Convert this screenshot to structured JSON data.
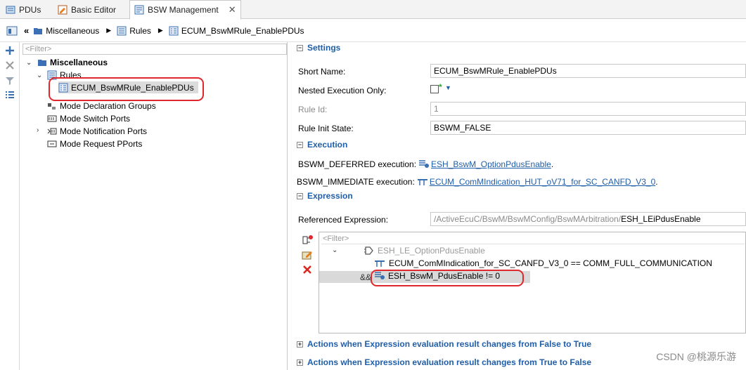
{
  "tabs": [
    {
      "label": "PDUs",
      "icon": "pdus-icon"
    },
    {
      "label": "Basic Editor",
      "icon": "basic-editor-icon"
    },
    {
      "label": "BSW Management",
      "icon": "bsw-management-icon",
      "close": "✕"
    }
  ],
  "breadcrumb": {
    "items": [
      "Miscellaneous",
      "Rules",
      "ECUM_BswMRule_EnablePDUs"
    ]
  },
  "tree": {
    "filter_placeholder": "<Filter>",
    "root": "Miscellaneous",
    "rules": "Rules",
    "selected_rule": "ECUM_BswMRule_EnablePDUs",
    "items": [
      "Mode Declaration Groups",
      "Mode Switch Ports",
      "Mode Notification Ports",
      "Mode Request PPorts"
    ]
  },
  "settings": {
    "title": "Settings",
    "short_name_label": "Short Name:",
    "short_name_value": "ECUM_BswMRule_EnablePDUs",
    "nested_label": "Nested Execution Only:",
    "rule_id_label": "Rule Id:",
    "rule_id_value": "1",
    "init_state_label": "Rule Init State:",
    "init_state_value": "BSWM_FALSE"
  },
  "execution": {
    "title": "Execution",
    "deferred_label": "BSWM_DEFERRED execution:",
    "deferred_link": "ESH_BswM_OptionPdusEnable",
    "immediate_label": "BSWM_IMMEDIATE execution:",
    "immediate_link": "ECUM_ComMIndication_HUT_oV71_for_SC_CANFD_V3_0"
  },
  "expression": {
    "title": "Expression",
    "ref_label": "Referenced Expression:",
    "ref_path": "/ActiveEcuC/BswM/BswMConfig/BswMArbitration/",
    "ref_name": "ESH_LEiPdusEnable",
    "filter_placeholder": "<Filter>",
    "group_node": "ESH_LE_OptionPdusEnable",
    "cond1": "ECUM_ComMIndication_for_SC_CANFD_V3_0 == COMM_FULL_COMMUNICATION",
    "and_op": "&&",
    "cond2": "ESH_BswM_PdusEnable != 0"
  },
  "actions": {
    "false_to_true": "Actions when Expression evaluation result changes from False to True",
    "true_to_false": "Actions when Expression evaluation result changes from True to False"
  },
  "watermark": "CSDN @桃源乐游",
  "colors": {
    "link": "#1f5ea8",
    "annotation": "#e0272d",
    "selected_row": "#d9d9d9"
  }
}
